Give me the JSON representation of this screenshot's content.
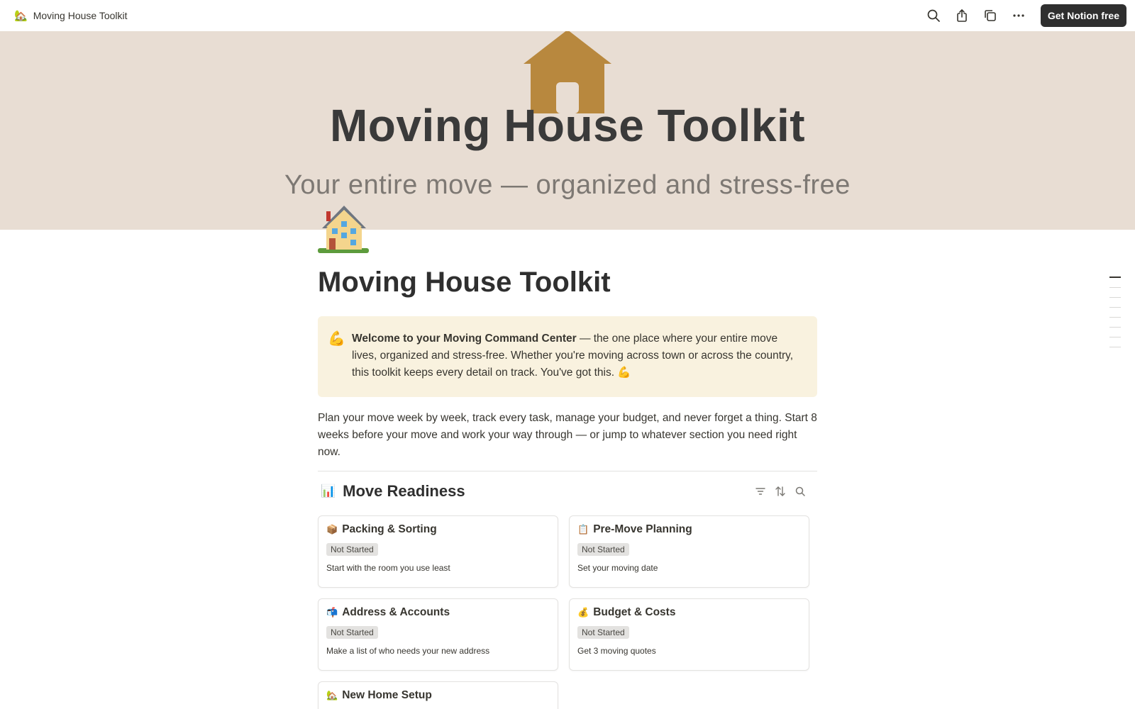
{
  "topbar": {
    "page_icon": "🏡",
    "page_name": "Moving House Toolkit",
    "icons": [
      "search-icon",
      "share-icon",
      "duplicate-icon",
      "more-icon"
    ],
    "cta_label": "Get Notion free"
  },
  "cover": {
    "title": "Moving House Toolkit",
    "subtitle": "Your entire move — organized and stress-free",
    "background": "#e8ddd3",
    "house_color": "#b8883e"
  },
  "page": {
    "icon": "🏡",
    "title": "Moving House Toolkit"
  },
  "callout": {
    "icon": "💪",
    "bold_text": "Welcome to your Moving Command Center",
    "text": " — the one place where your entire move lives, organized and stress-free. Whether you're moving across town or across the country, this toolkit keeps every detail on track. You've got this. 💪",
    "background": "#f9f2df"
  },
  "intro": "Plan your move week by week, track every task, manage your budget, and never forget a thing. Start 8 weeks before your move and work your way through — or jump to whatever section you need right now.",
  "database": {
    "icon": "📊",
    "title": "Move Readiness",
    "tools": [
      "filter-icon",
      "sort-icon",
      "search-icon"
    ],
    "cards": [
      {
        "icon": "📦",
        "title": "Packing & Sorting",
        "status": "Not Started",
        "desc": "Start with the room you use least"
      },
      {
        "icon": "📋",
        "title": "Pre-Move Planning",
        "status": "Not Started",
        "desc": "Set your moving date"
      },
      {
        "icon": "📬",
        "title": "Address & Accounts",
        "status": "Not Started",
        "desc": "Make a list of who needs your new address"
      },
      {
        "icon": "💰",
        "title": "Budget & Costs",
        "status": "Not Started",
        "desc": "Get 3 moving quotes"
      },
      {
        "icon": "🏡",
        "title": "New Home Setup"
      }
    ]
  }
}
